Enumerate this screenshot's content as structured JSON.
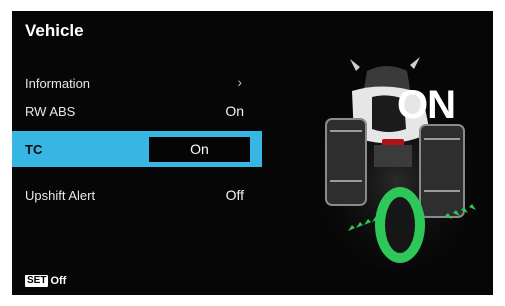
{
  "header": {
    "title": "Vehicle"
  },
  "menu": {
    "items": [
      {
        "label": "Information",
        "value": "",
        "chevron": "›"
      },
      {
        "label": "RW ABS",
        "value": "On"
      },
      {
        "label": "TC",
        "value": "On",
        "selected": true
      },
      {
        "label": "Upshift Alert",
        "value": "Off"
      }
    ]
  },
  "footer": {
    "set_badge": "SET",
    "set_value": "Off"
  },
  "status_display": {
    "big_text": "ON"
  },
  "colors": {
    "selected_row": "#37b6e4",
    "traction_ring": "#2ec85a"
  },
  "icons": [
    "chevron-right-icon",
    "motorcycle-traction-illustration",
    "arrow-chevron-icons"
  ]
}
